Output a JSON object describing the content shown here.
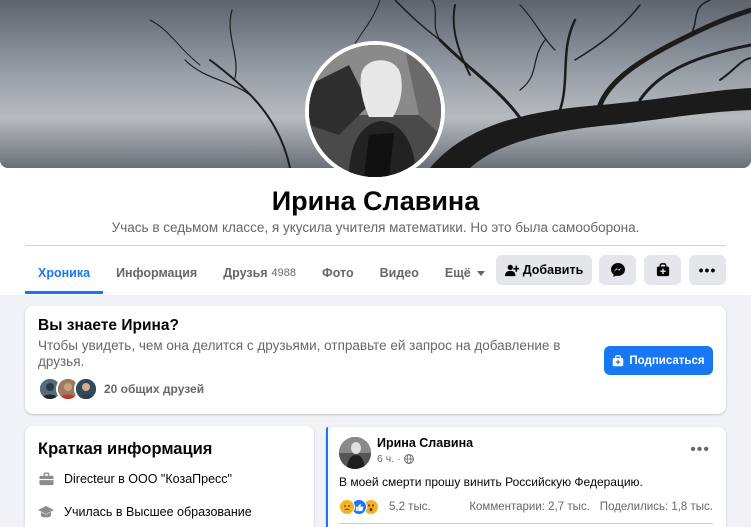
{
  "profile": {
    "name": "Ирина Славина",
    "bio": "Учась в седьмом классе, я укусила учителя математики. Но это была самооборона."
  },
  "tabs": [
    {
      "label": "Хроника",
      "active": true
    },
    {
      "label": "Информация"
    },
    {
      "label": "Друзья",
      "count": "4988"
    },
    {
      "label": "Фото"
    },
    {
      "label": "Видео"
    },
    {
      "label": "Ещё"
    }
  ],
  "actions": {
    "add_friend": "Добавить"
  },
  "know_card": {
    "title": "Вы знаете Ирина?",
    "text": "Чтобы увидеть, чем она делится с друзьями, отправьте ей запрос на добавление в друзья.",
    "subscribe": "Подписаться",
    "mutual": "20 общих друзей"
  },
  "intro": {
    "title": "Краткая информация",
    "work": "Directeur в ООО \"КозаПресс\"",
    "education": "Училась в Высшее образование"
  },
  "post": {
    "author": "Ирина Славина",
    "time": "6 ч.",
    "text": "В моей смерти прошу винить Российскую Федерацию.",
    "reactions": "5,2 тыс.",
    "comments": "Комментарии: 2,7 тыс.",
    "shares": "Поделились: 1,8 тыс."
  },
  "colors": {
    "accent": "#1877f2",
    "background": "#f0f2f5",
    "secondary_text": "#65676b"
  }
}
